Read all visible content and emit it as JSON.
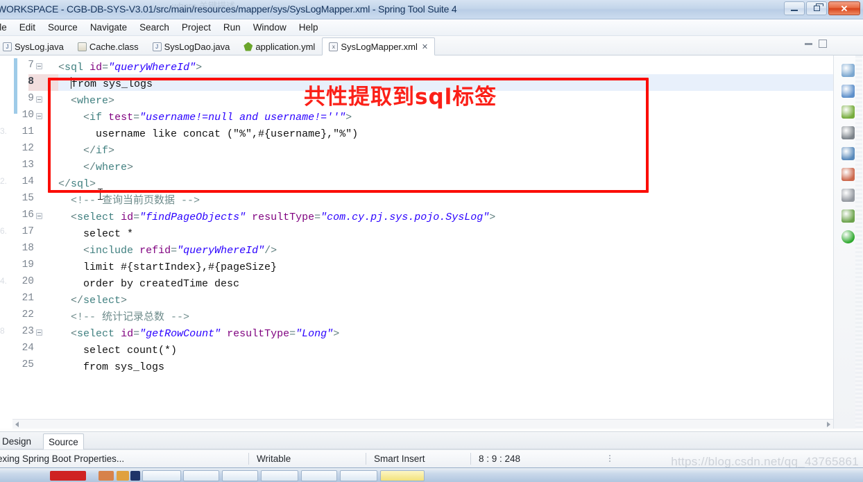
{
  "window": {
    "title": "WORKSPACE - CGB-DB-SYS-V3.01/src/main/resources/mapper/sys/SysLogMapper.xml - Spring Tool Suite 4",
    "minimize_label": "Minimize",
    "restore_label": "Restore",
    "close_label": "✕"
  },
  "menubar": {
    "items": [
      {
        "label": "File",
        "clipped": true
      },
      {
        "label": "Edit"
      },
      {
        "label": "Source"
      },
      {
        "label": "Navigate"
      },
      {
        "label": "Search"
      },
      {
        "label": "Project"
      },
      {
        "label": "Run"
      },
      {
        "label": "Window"
      },
      {
        "label": "Help"
      }
    ]
  },
  "editor_tabs": {
    "items": [
      {
        "label": "SysLog.java",
        "icon": "java-file-icon",
        "active": false,
        "icon_text": "J"
      },
      {
        "label": "Cache.class",
        "icon": "class-file-icon",
        "active": false,
        "icon_text": ""
      },
      {
        "label": "SysLogDao.java",
        "icon": "java-file-icon",
        "active": false,
        "icon_text": "J"
      },
      {
        "label": "application.yml",
        "icon": "yml-file-icon",
        "active": false,
        "icon_text": ""
      },
      {
        "label": "SysLogMapper.xml",
        "icon": "xml-file-icon",
        "active": true,
        "icon_text": "x"
      }
    ],
    "close_glyph": "✕",
    "minimize_view_label": "Minimize",
    "maximize_view_label": "Maximize"
  },
  "code": {
    "first_line": 7,
    "current_line": 8,
    "lines": [
      {
        "n": 7,
        "fold": true,
        "indent": 0,
        "tokens": [
          {
            "t": "bracket",
            "v": "<"
          },
          {
            "t": "tag",
            "v": "sql"
          },
          {
            "t": "plain",
            "v": " "
          },
          {
            "t": "attr",
            "v": "id"
          },
          {
            "t": "bracket",
            "v": "="
          },
          {
            "t": "val",
            "v": "\"queryWhereId\""
          },
          {
            "t": "bracket",
            "v": ">"
          }
        ]
      },
      {
        "n": 8,
        "fold": false,
        "indent": 1,
        "caret": true,
        "tokens": [
          {
            "t": "plain",
            "v": "from sys_logs"
          }
        ]
      },
      {
        "n": 9,
        "fold": true,
        "indent": 1,
        "tokens": [
          {
            "t": "bracket",
            "v": "<"
          },
          {
            "t": "tag",
            "v": "where"
          },
          {
            "t": "bracket",
            "v": ">"
          }
        ]
      },
      {
        "n": 10,
        "fold": true,
        "indent": 2,
        "tokens": [
          {
            "t": "bracket",
            "v": "<"
          },
          {
            "t": "tag",
            "v": "if"
          },
          {
            "t": "plain",
            "v": " "
          },
          {
            "t": "attr",
            "v": "test"
          },
          {
            "t": "bracket",
            "v": "="
          },
          {
            "t": "val",
            "v": "\"username!=null and username!=''\""
          },
          {
            "t": "bracket",
            "v": ">"
          }
        ]
      },
      {
        "n": 11,
        "fold": false,
        "indent": 3,
        "tokens": [
          {
            "t": "plain",
            "v": "username like concat (\"%\",#{username},\"%\")"
          }
        ]
      },
      {
        "n": 12,
        "fold": false,
        "indent": 2,
        "tokens": [
          {
            "t": "bracket",
            "v": "</"
          },
          {
            "t": "tag",
            "v": "if"
          },
          {
            "t": "bracket",
            "v": ">"
          }
        ]
      },
      {
        "n": 13,
        "fold": false,
        "indent": 2,
        "tokens": [
          {
            "t": "bracket",
            "v": "</"
          },
          {
            "t": "tag",
            "v": "where"
          },
          {
            "t": "bracket",
            "v": ">"
          }
        ]
      },
      {
        "n": 14,
        "fold": false,
        "indent": 0,
        "icaret": true,
        "tokens": [
          {
            "t": "bracket",
            "v": "</"
          },
          {
            "t": "tag",
            "v": "sql"
          },
          {
            "t": "bracket",
            "v": ">"
          }
        ]
      },
      {
        "n": 15,
        "fold": false,
        "indent": 1,
        "tokens": [
          {
            "t": "comment",
            "v": "<!-- 查询当前页数据 -->"
          }
        ]
      },
      {
        "n": 16,
        "fold": true,
        "indent": 1,
        "tokens": [
          {
            "t": "bracket",
            "v": "<"
          },
          {
            "t": "tag",
            "v": "select"
          },
          {
            "t": "plain",
            "v": " "
          },
          {
            "t": "attr",
            "v": "id"
          },
          {
            "t": "bracket",
            "v": "="
          },
          {
            "t": "val",
            "v": "\"findPageObjects\""
          },
          {
            "t": "plain",
            "v": " "
          },
          {
            "t": "attr",
            "v": "resultType"
          },
          {
            "t": "bracket",
            "v": "="
          },
          {
            "t": "val",
            "v": "\"com.cy.pj.sys.pojo.SysLog\""
          },
          {
            "t": "bracket",
            "v": ">"
          }
        ]
      },
      {
        "n": 17,
        "fold": false,
        "indent": 2,
        "tokens": [
          {
            "t": "plain",
            "v": "select *"
          }
        ]
      },
      {
        "n": 18,
        "fold": false,
        "indent": 2,
        "tokens": [
          {
            "t": "bracket",
            "v": "<"
          },
          {
            "t": "tag",
            "v": "include"
          },
          {
            "t": "plain",
            "v": " "
          },
          {
            "t": "attr",
            "v": "refid"
          },
          {
            "t": "bracket",
            "v": "="
          },
          {
            "t": "val",
            "v": "\"queryWhereId\""
          },
          {
            "t": "bracket",
            "v": "/>"
          }
        ]
      },
      {
        "n": 19,
        "fold": false,
        "indent": 2,
        "tokens": [
          {
            "t": "plain",
            "v": "limit #{startIndex},#{pageSize}"
          }
        ]
      },
      {
        "n": 20,
        "fold": false,
        "indent": 2,
        "tokens": [
          {
            "t": "plain",
            "v": "order by createdTime desc"
          }
        ]
      },
      {
        "n": 21,
        "fold": false,
        "indent": 1,
        "tokens": [
          {
            "t": "bracket",
            "v": "</"
          },
          {
            "t": "tag",
            "v": "select"
          },
          {
            "t": "bracket",
            "v": ">"
          }
        ]
      },
      {
        "n": 22,
        "fold": false,
        "indent": 1,
        "tokens": [
          {
            "t": "comment",
            "v": "<!-- 统计记录总数 -->"
          }
        ]
      },
      {
        "n": 23,
        "fold": true,
        "indent": 1,
        "tokens": [
          {
            "t": "bracket",
            "v": "<"
          },
          {
            "t": "tag",
            "v": "select"
          },
          {
            "t": "plain",
            "v": " "
          },
          {
            "t": "attr",
            "v": "id"
          },
          {
            "t": "bracket",
            "v": "="
          },
          {
            "t": "val",
            "v": "\"getRowCount\""
          },
          {
            "t": "plain",
            "v": " "
          },
          {
            "t": "attr",
            "v": "resultType"
          },
          {
            "t": "bracket",
            "v": "="
          },
          {
            "t": "val",
            "v": "\"Long\""
          },
          {
            "t": "bracket",
            "v": ">"
          }
        ]
      },
      {
        "n": 24,
        "fold": false,
        "indent": 2,
        "tokens": [
          {
            "t": "plain",
            "v": "select count(*)"
          }
        ]
      },
      {
        "n": 25,
        "fold": false,
        "indent": 2,
        "tokens": [
          {
            "t": "plain",
            "v": "from sys_logs"
          }
        ]
      }
    ],
    "ghost_ruler": [
      "3.",
      "2.",
      "6.",
      "4.",
      "8"
    ]
  },
  "annotation": {
    "note_text": "共性提取到sql标签",
    "box_color": "#fb0d06",
    "text_color": "#fb2018"
  },
  "bottom_tabs": {
    "items": [
      {
        "label": "Design",
        "active": false
      },
      {
        "label": "Source",
        "active": true
      }
    ]
  },
  "statusbar": {
    "task": "exing Spring Boot Properties...",
    "writable": "Writable",
    "insert_mode": "Smart Insert",
    "position": "8 : 9 : 248"
  },
  "right_rail": {
    "icons": [
      {
        "name": "link-with-editor-icon",
        "color": "#6f9fcc"
      },
      {
        "name": "bean-explorer-icon",
        "color": "#4f86c6"
      },
      {
        "name": "spring-boot-icon",
        "color": "#6aa52b"
      },
      {
        "name": "paperclip-icon",
        "color": "#707880"
      },
      {
        "name": "console-icon",
        "color": "#4a7fb5"
      },
      {
        "name": "debug-icon",
        "color": "#c85a3c"
      },
      {
        "name": "javadoc-icon",
        "color": "#8a8f97"
      },
      {
        "name": "install-icon",
        "color": "#5f9b3d"
      },
      {
        "name": "run-icon",
        "color": "#19a019"
      }
    ]
  },
  "watermarks": {
    "primary": "https://blog.csdn.net/qq_43765861",
    "secondary": "https://blog.csdn.net/qq_43765861",
    "top_ghost": "where 关键描述"
  },
  "scrollbars": {
    "vertical_label": "Vertical scrollbar",
    "horizontal_label": "Horizontal scrollbar"
  }
}
